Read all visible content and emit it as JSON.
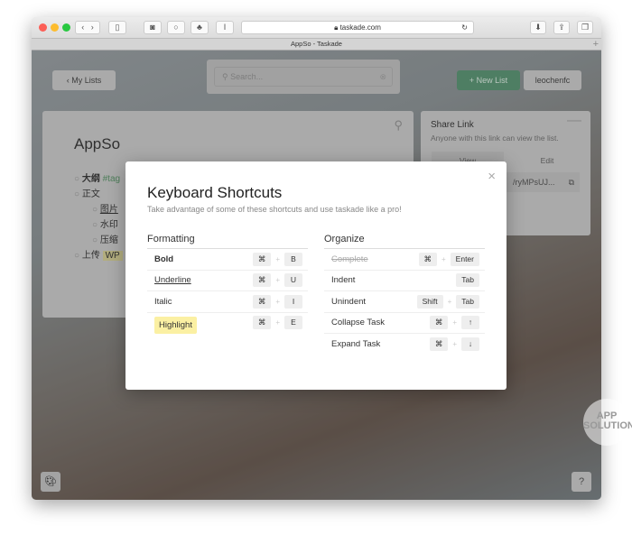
{
  "browser": {
    "url": "taskade.com",
    "tab_title": "AppSo - Taskade"
  },
  "header": {
    "back_label": "My Lists",
    "search_placeholder": "Search...",
    "new_list_label": "+ New List",
    "user_label": "leochenfc"
  },
  "list": {
    "title": "AppSo",
    "items": [
      {
        "text": "大纲",
        "tag": "#tag",
        "level": 0
      },
      {
        "text": "正文",
        "level": 0
      },
      {
        "text": "图片",
        "level": 1
      },
      {
        "text": "水印",
        "level": 1
      },
      {
        "text": "压缩",
        "level": 1
      },
      {
        "text": "上传",
        "highlight": "WP",
        "level": 0
      }
    ]
  },
  "share": {
    "title": "Share Link",
    "desc": "Anyone with this link can view the list.",
    "tab_view": "View",
    "tab_edit": "Edit",
    "link": "/ryMPsUJ..."
  },
  "modal": {
    "title": "Keyboard Shortcuts",
    "subtitle": "Take advantage of some of these shortcuts and use taskade like a pro!",
    "formatting": {
      "heading": "Formatting",
      "rows": [
        {
          "label": "Bold",
          "keys": [
            "⌘",
            "B"
          ]
        },
        {
          "label": "Underline",
          "keys": [
            "⌘",
            "U"
          ]
        },
        {
          "label": "Italic",
          "keys": [
            "⌘",
            "I"
          ]
        },
        {
          "label": "Highlight",
          "keys": [
            "⌘",
            "E"
          ]
        }
      ]
    },
    "organize": {
      "heading": "Organize",
      "rows": [
        {
          "label": "Complete",
          "keys": [
            "⌘",
            "Enter"
          ]
        },
        {
          "label": "Indent",
          "keys": [
            "Tab"
          ]
        },
        {
          "label": "Unindent",
          "keys": [
            "Shift",
            "Tab"
          ]
        },
        {
          "label": "Collapse Task",
          "keys": [
            "⌘",
            "↑"
          ]
        },
        {
          "label": "Expand Task",
          "keys": [
            "⌘",
            "↓"
          ]
        }
      ]
    }
  },
  "help_label": "?",
  "watermark": "APP SOLUTION",
  "colors": {
    "green": "#4a9a6c",
    "highlight": "#fbf0a3"
  }
}
